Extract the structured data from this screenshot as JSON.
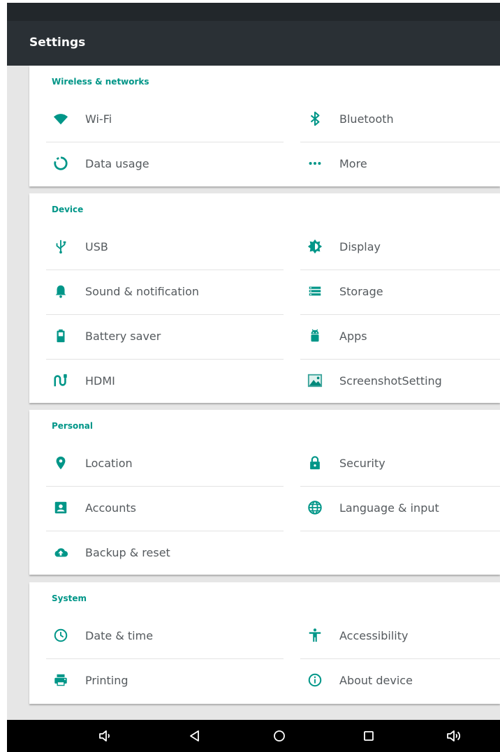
{
  "app_bar": {
    "title": "Settings"
  },
  "sections": [
    {
      "header": "Wireless & networks",
      "items": [
        {
          "label": "Wi-Fi",
          "icon": "wifi-icon"
        },
        {
          "label": "Bluetooth",
          "icon": "bluetooth-icon"
        },
        {
          "label": "Data usage",
          "icon": "data-usage-icon"
        },
        {
          "label": "More",
          "icon": "more-dots-icon"
        }
      ]
    },
    {
      "header": "Device",
      "items": [
        {
          "label": "USB",
          "icon": "usb-icon"
        },
        {
          "label": "Display",
          "icon": "brightness-icon"
        },
        {
          "label": "Sound & notification",
          "icon": "bell-icon"
        },
        {
          "label": "Storage",
          "icon": "storage-icon"
        },
        {
          "label": "Battery saver",
          "icon": "battery-icon"
        },
        {
          "label": "Apps",
          "icon": "android-icon"
        },
        {
          "label": "HDMI",
          "icon": "hdmi-icon"
        },
        {
          "label": "ScreenshotSetting",
          "icon": "screenshot-icon"
        }
      ]
    },
    {
      "header": "Personal",
      "items": [
        {
          "label": "Location",
          "icon": "location-pin-icon"
        },
        {
          "label": "Security",
          "icon": "lock-icon"
        },
        {
          "label": "Accounts",
          "icon": "account-box-icon"
        },
        {
          "label": "Language & input",
          "icon": "globe-icon"
        },
        {
          "label": "Backup & reset",
          "icon": "cloud-upload-icon"
        }
      ]
    },
    {
      "header": "System",
      "items": [
        {
          "label": "Date & time",
          "icon": "clock-icon"
        },
        {
          "label": "Accessibility",
          "icon": "accessibility-icon"
        },
        {
          "label": "Printing",
          "icon": "printer-icon"
        },
        {
          "label": "About device",
          "icon": "info-icon"
        }
      ]
    }
  ],
  "nav_bar": {
    "buttons": [
      "volume-down-icon",
      "back-icon",
      "home-icon",
      "recents-icon",
      "volume-up-icon"
    ]
  },
  "colors": {
    "accent": "#009688",
    "app_bar": "#2a3035",
    "status_bar": "#22272b",
    "nav_bar": "#000000",
    "background": "#e6e6e6"
  }
}
